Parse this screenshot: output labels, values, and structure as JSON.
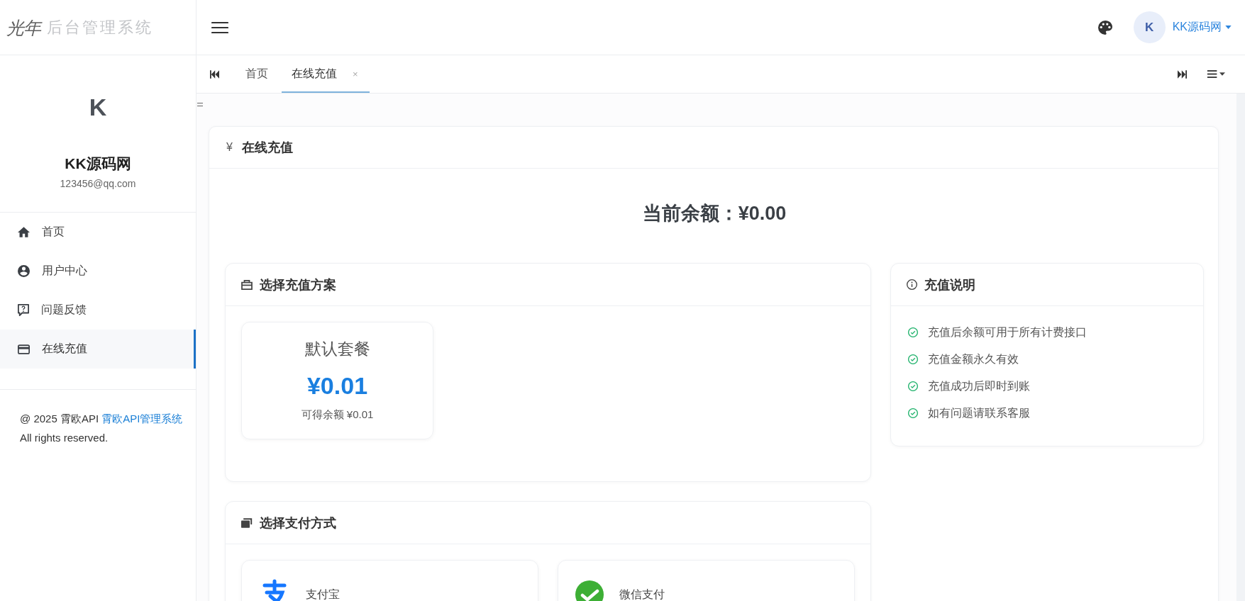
{
  "sidebar": {
    "logo": {
      "mark": "光年",
      "text": "后台管理系统"
    },
    "profile": {
      "initial": "K",
      "name": "KK源码网",
      "email": "123456@qq.com"
    },
    "items": [
      {
        "label": "首页",
        "selected": false
      },
      {
        "label": "用户中心",
        "selected": false
      },
      {
        "label": "问题反馈",
        "selected": false
      },
      {
        "label": "在线充值",
        "selected": true
      }
    ],
    "footer": {
      "text": "@ 2025 霄欧API",
      "link": "霄欧API管理系统",
      "tail": "All rights reserved."
    }
  },
  "header": {
    "user": {
      "initial": "K",
      "name": "KK源码网"
    }
  },
  "tabs": [
    {
      "label": "首页",
      "selected": false
    },
    {
      "label": "在线充值",
      "selected": true,
      "close": "×"
    }
  ],
  "page": {
    "title_glyph": "¥",
    "title": "在线充值",
    "balance": "当前余额：¥0.00",
    "plans": {
      "title": "选择充值方案",
      "items": [
        {
          "name": "默认套餐",
          "price": "¥0.01",
          "credit": "可得余额 ¥0.01"
        }
      ]
    },
    "notes": {
      "title": "充值说明",
      "items": [
        "充值后余额可用于所有计费接口",
        "充值金额永久有效",
        "充值成功后即时到账",
        "如有问题请联系客服"
      ]
    },
    "payment": {
      "title": "选择支付方式",
      "methods": [
        {
          "kind": "alipay",
          "label": "支付宝"
        },
        {
          "kind": "wechat",
          "label": "微信支付"
        }
      ]
    }
  }
}
